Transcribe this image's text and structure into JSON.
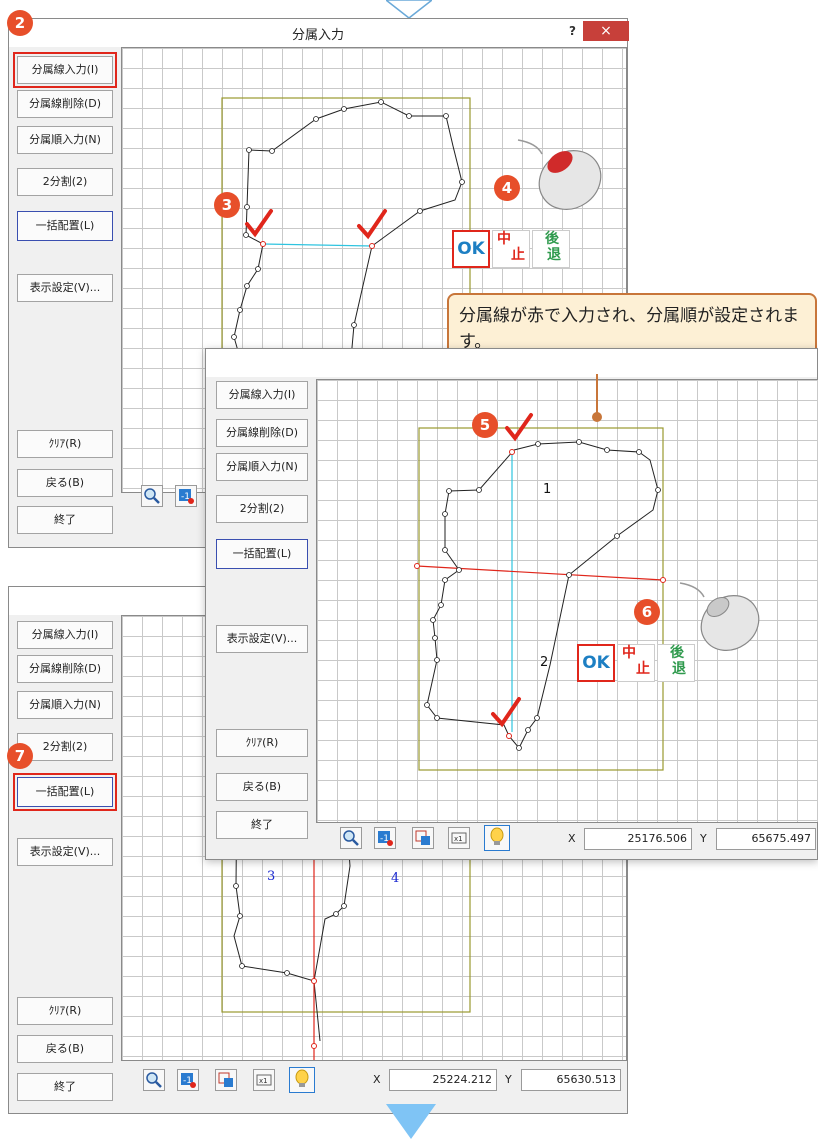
{
  "window1": {
    "title": "分属入力",
    "help": "?",
    "close": "×"
  },
  "buttons": {
    "line_input": "分属線入力(I)",
    "line_delete": "分属線削除(D)",
    "order_input": "分属順入力(N)",
    "split2": "2分割(2)",
    "bulk": "一括配置(L)",
    "display": "表示設定(V)...",
    "clear": "ｸﾘｱ(R)",
    "back": "戻る(B)",
    "exit": "終了"
  },
  "steps": [
    "2",
    "3",
    "4",
    "5",
    "6",
    "7"
  ],
  "ok_panel": {
    "ok": "OK",
    "stop_top": "中",
    "stop_bottom": "止",
    "back_top": "後",
    "back_bottom": "退"
  },
  "callout": "分属線が赤で入力され、分属順が設定されます。",
  "window2": {
    "x_label": "X",
    "x_value": "25176.506",
    "y_label": "Y",
    "y_value": "65675.497",
    "labels": [
      "1",
      "2"
    ]
  },
  "window3": {
    "x_label": "X",
    "x_value": "25224.212",
    "y_label": "Y",
    "y_value": "65630.513",
    "labels": [
      "3",
      "4"
    ]
  },
  "colors": {
    "badge": "#e74f2a",
    "highlight": "#e0261b",
    "cyan_line": "#2ec4e0",
    "red_line": "#e0261b",
    "frame": "#9a9a30",
    "arrow": "#7fc4f5"
  },
  "icons": [
    "zoom-icon",
    "scale-icon",
    "move-icon",
    "fit-icon",
    "bulb-icon",
    "mouse-icon",
    "check-icon"
  ]
}
